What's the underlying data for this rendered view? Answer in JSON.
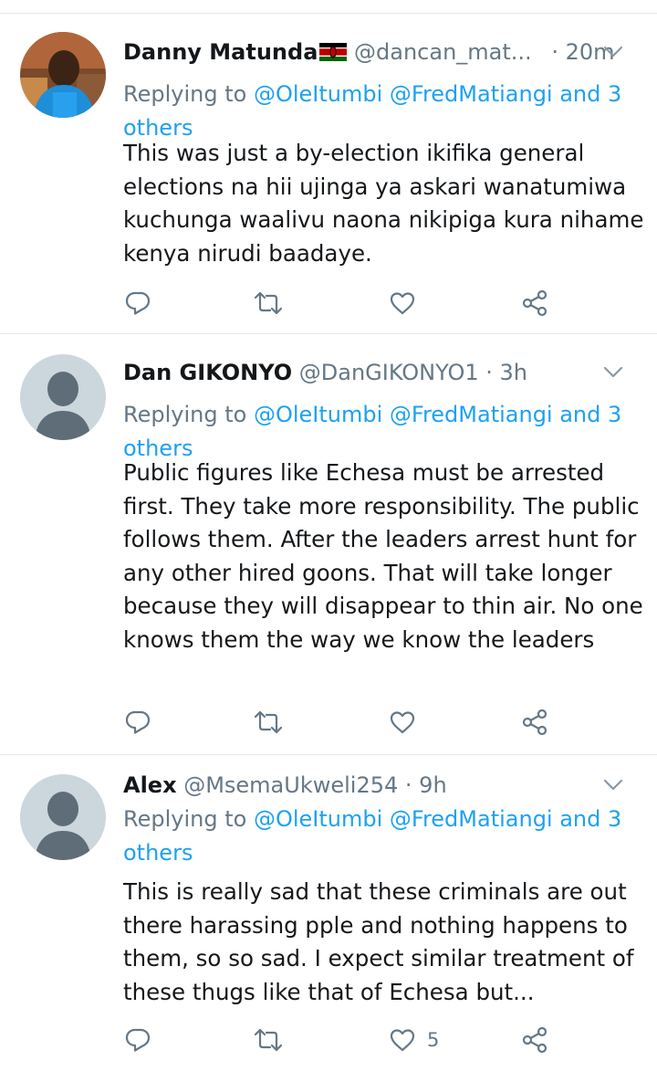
{
  "tweets": [
    {
      "name": "Danny Matunda",
      "handle": "@dancan_mat...",
      "time": "· 20m",
      "reply_prefix": "Replying to",
      "reply_targets": "@OleItumbi @FredMatiangi and 3 others",
      "text": "This was just a by-election ikifika general elections na hii ujinga ya askari wanatumiwa kuchunga waalivu naona nikipiga kura nihame kenya nirudi baadaye.",
      "like_count": ""
    },
    {
      "name": "Dan GIKONYO",
      "handle": "@DanGIKONYO1",
      "time": "· 3h",
      "reply_prefix": "Replying to",
      "reply_targets": "@OleItumbi @FredMatiangi and 3 others",
      "text": "Public figures like Echesa must be arrested first. They take more responsibility. The public follows them. After the leaders arrest hunt for any other hired goons. That will take longer because they will disappear to thin air. No one knows them the way we know the leaders",
      "like_count": ""
    },
    {
      "name": "Alex",
      "handle": "@MsemaUkweli254",
      "time": "· 9h",
      "reply_prefix": "Replying to",
      "reply_targets": "@OleItumbi @FredMatiangi and 3 others",
      "text": "This is really sad that these criminals are out there harassing pple and nothing happens to them, so so sad. I expect similar treatment of these thugs like that of Echesa but...",
      "like_count": "5"
    }
  ],
  "colors": {
    "link": "#1da1f2",
    "secondary": "#657786",
    "text": "#14171a",
    "divider": "#e1e8ed",
    "avatar_default_bg": "#ccd6dd",
    "avatar_default_fg": "#5e6d77"
  }
}
